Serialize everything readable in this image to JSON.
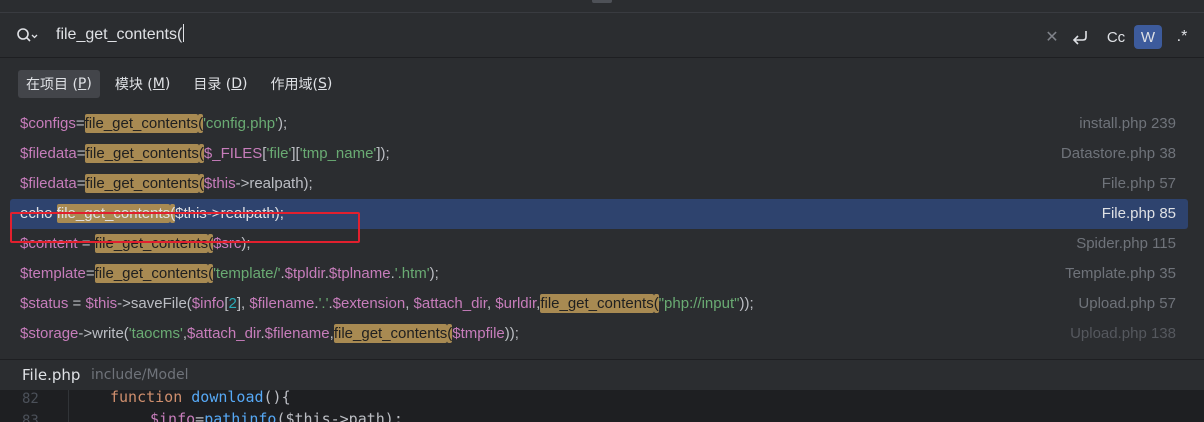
{
  "search": {
    "query": "file_get_contents(",
    "icon": "search-icon",
    "tools": {
      "clear_icon": "close-icon",
      "newline_icon": "newline-icon",
      "match_case": "Cc",
      "words": "W",
      "regex": ".*"
    }
  },
  "scopes": [
    {
      "label": "在项目 (",
      "key": "P",
      "suffix": ")"
    },
    {
      "label": "模块 (",
      "key": "M",
      "suffix": ")"
    },
    {
      "label": "目录 (",
      "key": "D",
      "suffix": ")"
    },
    {
      "label": "作用域(",
      "key": "S",
      "suffix": ")"
    }
  ],
  "results": [
    {
      "location": "install.php 239",
      "parts": [
        [
          "var",
          "$configs"
        ],
        [
          "txt",
          "="
        ],
        [
          "hl",
          "file_get_contents"
        ],
        [
          "hl",
          "("
        ],
        [
          "str",
          "'config.php'"
        ],
        [
          "txt",
          ");"
        ]
      ]
    },
    {
      "location": "Datastore.php 38",
      "parts": [
        [
          "var",
          "$filedata"
        ],
        [
          "txt",
          "="
        ],
        [
          "hl",
          "file_get_contents"
        ],
        [
          "hl",
          "("
        ],
        [
          "var",
          "$_FILES"
        ],
        [
          "txt",
          "["
        ],
        [
          "str",
          "'file'"
        ],
        [
          "txt",
          "]["
        ],
        [
          "str",
          "'tmp_name'"
        ],
        [
          "txt",
          "]);"
        ]
      ]
    },
    {
      "location": "File.php 57",
      "parts": [
        [
          "var",
          "$filedata"
        ],
        [
          "txt",
          "="
        ],
        [
          "hl",
          "file_get_contents"
        ],
        [
          "hl",
          "("
        ],
        [
          "var",
          "$this"
        ],
        [
          "txt",
          "->realpath);"
        ]
      ]
    },
    {
      "location": "File.php 85",
      "selected": true,
      "parts": [
        [
          "txt",
          "echo "
        ],
        [
          "hl",
          "file_get_contents"
        ],
        [
          "hl",
          "("
        ],
        [
          "var",
          "$this"
        ],
        [
          "txt",
          "->realpath);"
        ]
      ]
    },
    {
      "location": "Spider.php 115",
      "parts": [
        [
          "var",
          "$content"
        ],
        [
          "txt",
          " = "
        ],
        [
          "hl",
          "file_get_contents"
        ],
        [
          "hl",
          "("
        ],
        [
          "var",
          "$src"
        ],
        [
          "txt",
          ");"
        ]
      ]
    },
    {
      "location": "Template.php 35",
      "parts": [
        [
          "var",
          "$template"
        ],
        [
          "txt",
          "="
        ],
        [
          "hl",
          "file_get_contents"
        ],
        [
          "hl",
          "("
        ],
        [
          "str",
          "'template/'"
        ],
        [
          "txt",
          "."
        ],
        [
          "var",
          "$tpldir"
        ],
        [
          "txt",
          "."
        ],
        [
          "var",
          "$tplname"
        ],
        [
          "txt",
          "."
        ],
        [
          "str",
          "'.htm'"
        ],
        [
          "txt",
          ");"
        ]
      ]
    },
    {
      "location": "Upload.php 57",
      "parts": [
        [
          "var",
          "$status"
        ],
        [
          "txt",
          " = "
        ],
        [
          "var",
          "$this"
        ],
        [
          "txt",
          "->saveFile("
        ],
        [
          "var",
          "$info"
        ],
        [
          "txt",
          "["
        ],
        [
          "num",
          "2"
        ],
        [
          "txt",
          "], "
        ],
        [
          "var",
          "$filename"
        ],
        [
          "txt",
          "."
        ],
        [
          "str",
          "'.'"
        ],
        [
          "txt",
          "."
        ],
        [
          "var",
          "$extension"
        ],
        [
          "txt",
          ", "
        ],
        [
          "var",
          "$attach_dir"
        ],
        [
          "txt",
          ", "
        ],
        [
          "var",
          "$urldir"
        ],
        [
          "txt",
          ","
        ],
        [
          "hl",
          "file_get_contents"
        ],
        [
          "hl",
          "("
        ],
        [
          "str",
          "\"php://input\""
        ],
        [
          "txt",
          "));"
        ]
      ]
    },
    {
      "location": "Upload.php 138",
      "dim": true,
      "parts": [
        [
          "var",
          "$storage"
        ],
        [
          "txt",
          "->write("
        ],
        [
          "str",
          "'taocms'"
        ],
        [
          "txt",
          ","
        ],
        [
          "var",
          "$attach_dir"
        ],
        [
          "txt",
          "."
        ],
        [
          "var",
          "$filename"
        ],
        [
          "txt",
          ","
        ],
        [
          "hl",
          "file_get_contents"
        ],
        [
          "hl",
          "("
        ],
        [
          "var",
          "$tmpfile"
        ],
        [
          "txt",
          "));"
        ]
      ]
    }
  ],
  "footer": {
    "file_name": "File.php",
    "file_path": "include/Model"
  },
  "editor": {
    "line1": "82",
    "line2": "83",
    "kw_function": "function",
    "fn_name": "download",
    "parens_brace": "(){",
    "line2_var": "$info",
    "line2_eq": "=",
    "line2_fn": "pathinfo",
    "line2_rest": "($this->path);"
  }
}
